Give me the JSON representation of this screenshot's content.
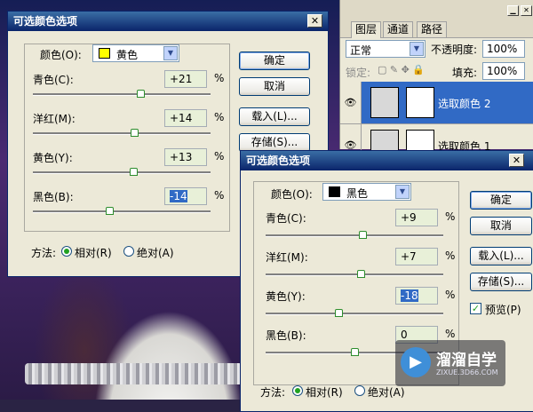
{
  "dialog1": {
    "title": "可选颜色选项",
    "close": "✕",
    "color_label": "颜色(O):",
    "color_value": "黄色",
    "color_swatch": "#ffff00",
    "sliders": [
      {
        "label": "青色(C):",
        "value": "+21",
        "pct": "%",
        "level": 0.605
      },
      {
        "label": "洋红(M):",
        "value": "+14",
        "pct": "%",
        "level": 0.57
      },
      {
        "label": "黄色(Y):",
        "value": "+13",
        "pct": "%",
        "level": 0.565
      },
      {
        "label": "黑色(B):",
        "value": "-14",
        "pct": "%",
        "level": 0.43
      }
    ],
    "buttons": {
      "ok": "确定",
      "cancel": "取消",
      "load": "载入(L)...",
      "save": "存储(S)..."
    },
    "method_label": "方法:",
    "relative": "相对(R)",
    "absolute": "绝对(A)"
  },
  "dialog2": {
    "title": "可选颜色选项",
    "close": "✕",
    "color_label": "颜色(O):",
    "color_value": "黑色",
    "color_swatch": "#000000",
    "sliders": [
      {
        "label": "青色(C):",
        "value": "+9",
        "pct": "%",
        "level": 0.545
      },
      {
        "label": "洋红(M):",
        "value": "+7",
        "pct": "%",
        "level": 0.535
      },
      {
        "label": "黄色(Y):",
        "value": "-18",
        "pct": "%",
        "level": 0.41
      },
      {
        "label": "黑色(B):",
        "value": "0",
        "pct": "%",
        "level": 0.5
      }
    ],
    "buttons": {
      "ok": "确定",
      "cancel": "取消",
      "load": "载入(L)...",
      "save": "存储(S)..."
    },
    "preview": "预览(P)",
    "method_label": "方法:",
    "relative": "相对(R)",
    "absolute": "绝对(A)"
  },
  "layers": {
    "tabs": [
      "图层",
      "通道",
      "路径"
    ],
    "blend_mode": "正常",
    "opacity_label": "不透明度:",
    "opacity": "100%",
    "lock_label": "锁定:",
    "fill_label": "填充:",
    "fill": "100%",
    "rows": [
      {
        "name": "选取颜色 2",
        "selected": true
      },
      {
        "name": "选取颜色 1",
        "selected": false
      }
    ]
  },
  "watermark": {
    "name": "溜溜自学",
    "url": "ZIXUE.3D66.COM"
  }
}
